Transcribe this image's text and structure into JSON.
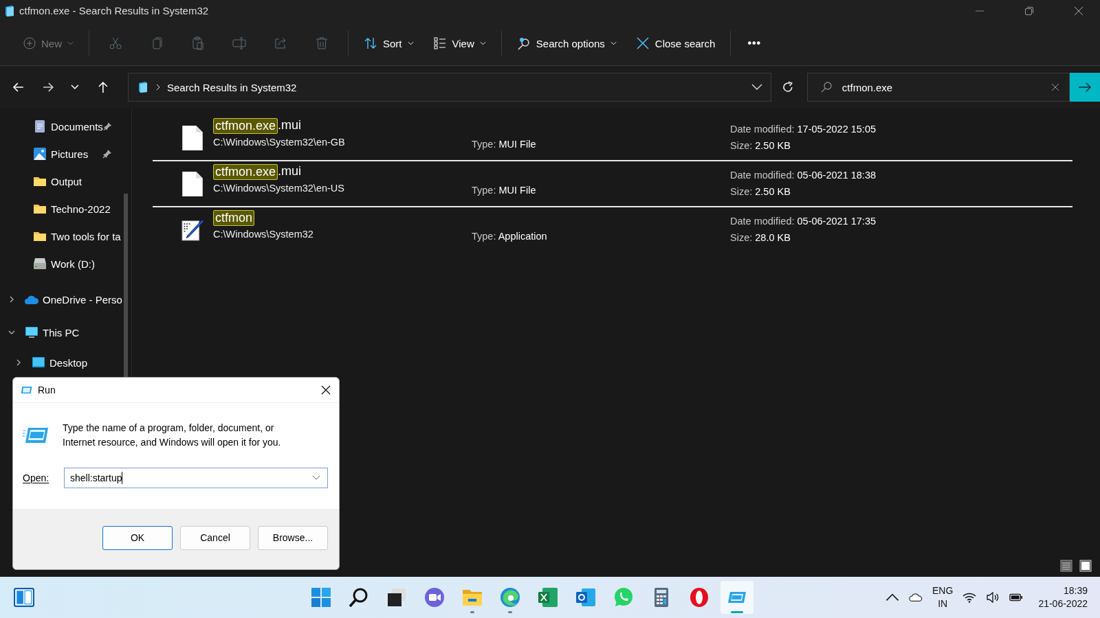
{
  "window": {
    "title": "ctfmon.exe - Search Results in System32"
  },
  "toolbar": {
    "new": {
      "label": "New",
      "disabled": true
    },
    "actions": [
      {
        "kind": "cut",
        "disabled": true
      },
      {
        "kind": "copy",
        "disabled": true
      },
      {
        "kind": "paste",
        "disabled": true
      },
      {
        "kind": "rename",
        "disabled": true
      },
      {
        "kind": "share",
        "disabled": true
      },
      {
        "kind": "delete",
        "disabled": true
      }
    ],
    "sort": {
      "label": "Sort"
    },
    "view": {
      "label": "View"
    },
    "search_options": {
      "label": "Search options"
    },
    "close_search": {
      "label": "Close search"
    },
    "more": {
      "label": "•••"
    }
  },
  "address": {
    "path": "Search Results in System32"
  },
  "search": {
    "value": "ctfmon.exe"
  },
  "sidebar": {
    "quick_access": [
      {
        "kind": "documents",
        "label": "Documents",
        "pinned": true
      },
      {
        "kind": "pictures",
        "label": "Pictures",
        "pinned": true
      },
      {
        "kind": "folder",
        "label": "Output",
        "pinned": false
      },
      {
        "kind": "folder",
        "label": "Techno-2022",
        "pinned": false
      },
      {
        "kind": "folder",
        "label": "Two tools for ta",
        "pinned": false
      },
      {
        "kind": "drive",
        "label": "Work (D:)",
        "pinned": false
      }
    ],
    "tree": [
      {
        "kind": "cloud",
        "label": "OneDrive - Perso",
        "expanded": false
      },
      {
        "kind": "pc",
        "label": "This PC",
        "expanded": true,
        "children": [
          {
            "kind": "desktop",
            "label": "Desktop",
            "expanded": false
          }
        ]
      }
    ]
  },
  "results": [
    {
      "kind": "file",
      "match": "ctfmon.exe",
      "rest": ".mui",
      "path": "C:\\Windows\\System32\\en-GB",
      "type_label": "Type:",
      "type": "MUI File",
      "date_label": "Date modified:",
      "date": "17-05-2022 15:05",
      "size_label": "Size:",
      "size": "2.50 KB"
    },
    {
      "kind": "file",
      "match": "ctfmon.exe",
      "rest": ".mui",
      "path": "C:\\Windows\\System32\\en-US",
      "type_label": "Type:",
      "type": "MUI File",
      "date_label": "Date modified:",
      "date": "05-06-2021 18:38",
      "size_label": "Size:",
      "size": "2.50 KB"
    },
    {
      "kind": "app",
      "match": "ctfmon",
      "path": "C:\\Windows\\System32",
      "type_label": "Type:",
      "type": "Application",
      "date_label": "Date modified:",
      "date": "05-06-2021 17:35",
      "size_label": "Size:",
      "size": "28.0 KB"
    }
  ],
  "run_dialog": {
    "title": "Run",
    "message": "Type the name of a program, folder, document, or Internet resource, and Windows will open it for you.",
    "open_label": "Open:",
    "value": "shell:startup",
    "buttons": [
      {
        "label": "OK",
        "default": true
      },
      {
        "label": "Cancel",
        "default": false
      },
      {
        "label": "Browse...",
        "default": false
      }
    ]
  },
  "taskbar": {
    "apps": [
      {
        "kind": "start",
        "running": false,
        "active": false
      },
      {
        "kind": "search",
        "running": false,
        "active": false
      },
      {
        "kind": "taskview",
        "running": false,
        "active": false
      },
      {
        "kind": "chat",
        "running": false,
        "active": false
      },
      {
        "kind": "explorer",
        "running": true,
        "active": false
      },
      {
        "kind": "edge",
        "running": true,
        "active": false
      },
      {
        "kind": "excel",
        "running": false,
        "active": false
      },
      {
        "kind": "outlook",
        "running": false,
        "active": false
      },
      {
        "kind": "whatsapp",
        "running": false,
        "active": false
      },
      {
        "kind": "calculator",
        "running": false,
        "active": false
      },
      {
        "kind": "opera",
        "running": false,
        "active": false
      },
      {
        "kind": "run",
        "running": true,
        "active": true
      }
    ],
    "language": "ENG",
    "region": "IN",
    "time": "18:39",
    "date": "21-06-2022"
  }
}
